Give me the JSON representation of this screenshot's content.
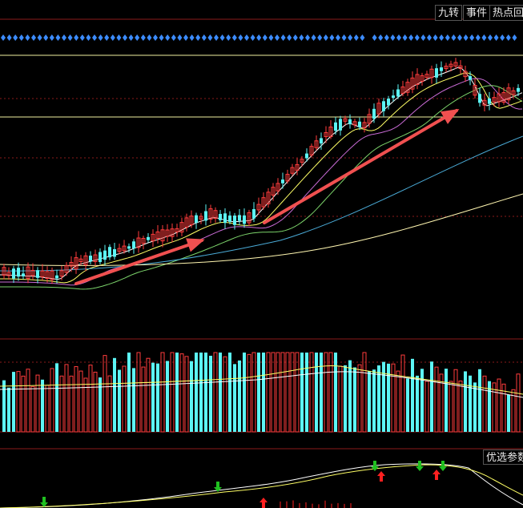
{
  "toolbar": {
    "jiuzhuan_label": "九转",
    "event_label": "事件",
    "hotspot_label": "热点回"
  },
  "indicator_panel": {
    "params_label": "优选参数"
  },
  "colors": {
    "up": "#ff3d3d",
    "down": "#5cf5f5",
    "ma5": "#ffffff",
    "ma10": "#ffff66",
    "ma20": "#c96bd6",
    "ma30": "#7cd46b",
    "ma60": "#4aaad6",
    "ma120": "#fff6b0",
    "arrow": "#f05050",
    "grid": "#8a1a1a",
    "level": "#f0f0a0",
    "diamond": "#3c8cff",
    "signal_buy": "#ff2020",
    "signal_sell": "#20c020"
  },
  "icons": {
    "buy_signal": "up-arrow-icon",
    "sell_signal": "down-arrow-icon",
    "trend": "trend-arrow-icon",
    "marker": "diamond-icon"
  }
}
